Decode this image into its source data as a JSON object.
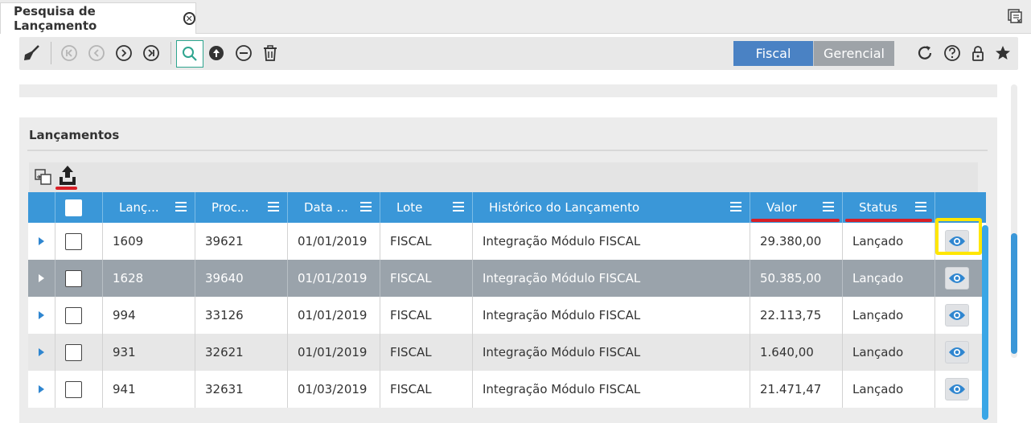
{
  "tab": {
    "title": "Pesquisa de Lançamento",
    "close_glyph": "✕"
  },
  "toolbar": {
    "icons": [
      "broom-icon",
      "first-record-icon",
      "previous-record-icon",
      "next-record-icon",
      "last-record-icon",
      "search-icon",
      "upload-icon",
      "remove-icon",
      "trash-icon",
      "refresh-icon",
      "help-icon",
      "lock-icon",
      "star-icon"
    ],
    "toggle": {
      "fiscal_label": "Fiscal",
      "gerencial_label": "Gerencial",
      "selected": "Fiscal"
    }
  },
  "panel": {
    "title": "Lançamentos"
  },
  "grid": {
    "columns": {
      "lancamento": "Lanç...",
      "processo": "Proc...",
      "data": "Data ...",
      "lote": "Lote",
      "historico": "Histórico do Lançamento",
      "valor": "Valor",
      "status": "Status"
    },
    "rows": [
      {
        "lancamento": "1609",
        "processo": "39621",
        "data": "01/01/2019",
        "lote": "FISCAL",
        "historico": "Integração Módulo FISCAL",
        "valor": "29.380,00",
        "status": "Lançado"
      },
      {
        "lancamento": "1628",
        "processo": "39640",
        "data": "01/01/2019",
        "lote": "FISCAL",
        "historico": "Integração Módulo FISCAL",
        "valor": "50.385,00",
        "status": "Lançado"
      },
      {
        "lancamento": "994",
        "processo": "33126",
        "data": "01/01/2019",
        "lote": "FISCAL",
        "historico": "Integração Módulo FISCAL",
        "valor": "22.113,75",
        "status": "Lançado"
      },
      {
        "lancamento": "931",
        "processo": "32621",
        "data": "01/01/2019",
        "lote": "FISCAL",
        "historico": "Integração Módulo FISCAL",
        "valor": "1.640,00",
        "status": "Lançado"
      },
      {
        "lancamento": "941",
        "processo": "32631",
        "data": "01/03/2019",
        "lote": "FISCAL",
        "historico": "Integração Módulo FISCAL",
        "valor": "21.471,47",
        "status": "Lançado"
      }
    ]
  },
  "colors": {
    "header_blue": "#3a97d8",
    "fiscal_blue": "#4a82c4",
    "selected_row": "#9aa3ab",
    "annotation_red": "#d81f26",
    "annotation_yellow": "#ffe600"
  }
}
